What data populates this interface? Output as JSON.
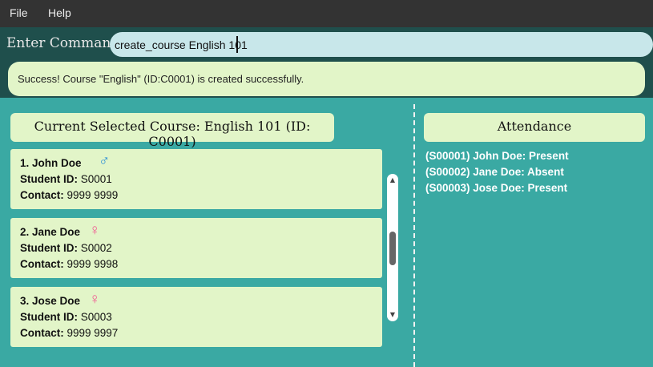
{
  "menu": {
    "file": "File",
    "help": "Help"
  },
  "command": {
    "label": "Enter Command:",
    "value": "create_course English 101",
    "result": "Success! Course \"English\" (ID:C0001) is created successfully."
  },
  "course": {
    "header": "Current Selected Course: English 101 (ID: C0001)"
  },
  "students": [
    {
      "name": "1. John Doe",
      "gender_icon": "♂",
      "gender": "male",
      "id_label": "Student ID:",
      "id": " S0001",
      "contact_label": "Contact:",
      "contact": " 9999 9999"
    },
    {
      "name": "2. Jane Doe",
      "gender_icon": "♀",
      "gender": "female",
      "id_label": "Student ID:",
      "id": " S0002",
      "contact_label": "Contact:",
      "contact": " 9999 9998"
    },
    {
      "name": "3. Jose Doe",
      "gender_icon": "♀",
      "gender": "female",
      "id_label": "Student ID:",
      "id": " S0003",
      "contact_label": "Contact:",
      "contact": " 9999 9997"
    }
  ],
  "scrollbar": {
    "up": "▲",
    "down": "▼"
  },
  "attendance": {
    "header": "Attendance",
    "records": [
      "(S00001) John Doe: Present",
      "(S00002) Jane Doe: Absent",
      "(S00003) Jose Doe: Present"
    ]
  },
  "colors": {
    "background": "#3aa9a3",
    "menubar": "#333333",
    "command_area": "#1f4f4c",
    "card": "#e2f5c8",
    "input": "#c8e7ea",
    "male": "#2b8fd6",
    "female": "#f15a92"
  }
}
